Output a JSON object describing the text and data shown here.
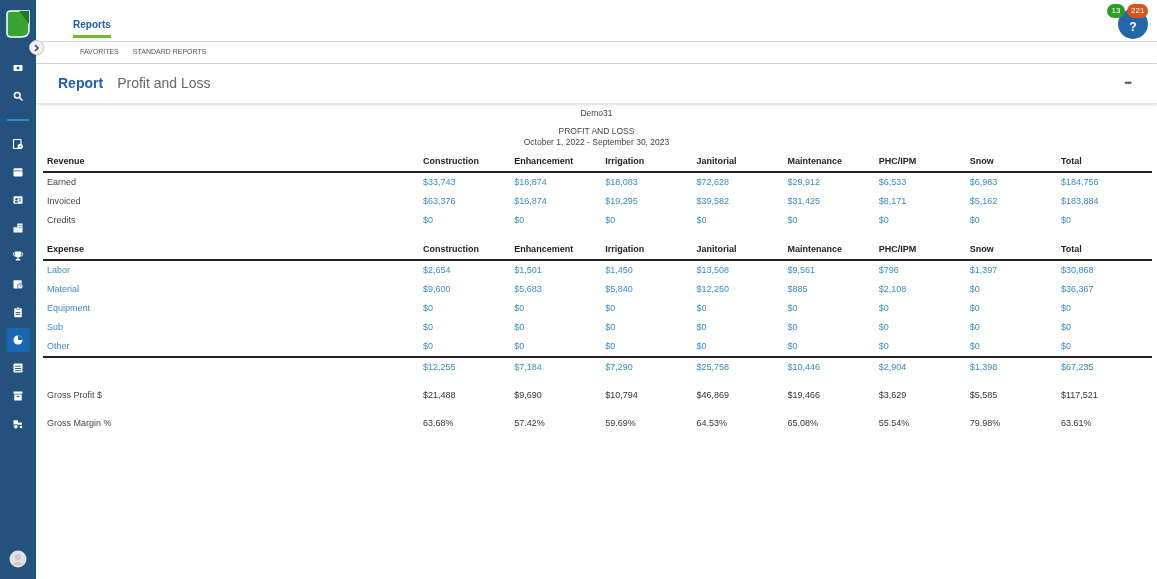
{
  "sidebar": {
    "items": [
      {
        "kind": "cash",
        "selected": false
      },
      {
        "kind": "search",
        "selected": false
      },
      {
        "kind": "divider"
      },
      {
        "kind": "calendar-check",
        "selected": false
      },
      {
        "kind": "calendar",
        "selected": false
      },
      {
        "kind": "contact-card",
        "selected": false
      },
      {
        "kind": "buildings",
        "selected": false
      },
      {
        "kind": "trophy",
        "selected": false
      },
      {
        "kind": "calendar-clock",
        "selected": false
      },
      {
        "kind": "clipboard",
        "selected": false
      },
      {
        "kind": "pie",
        "selected": true
      },
      {
        "kind": "list",
        "selected": false
      },
      {
        "kind": "archive",
        "selected": false
      },
      {
        "kind": "tractor",
        "selected": false
      }
    ]
  },
  "tabs": [
    {
      "label": "Reports",
      "selected": true
    }
  ],
  "subtabs": [
    {
      "label": "FAVORITES"
    },
    {
      "label": "STANDARD REPORTS"
    }
  ],
  "help": {
    "label": "?",
    "badges": [
      {
        "text": "13",
        "color": "#2e9b2b"
      },
      {
        "text": "221",
        "color": "#d9531e"
      }
    ]
  },
  "header": {
    "title": "Report",
    "subtitle": "Profit and Loss",
    "menu": "•••"
  },
  "report": {
    "company": "Demo31",
    "title": "PROFIT AND LOSS",
    "period": "October 1, 2022 - September 30, 2023",
    "rows": [
      {
        "kind": "header",
        "cells": [
          "Revenue",
          "Construction",
          "Enhancement",
          "Irrigation",
          "Janitorial",
          "Maintenance",
          "PHC/IPM",
          "Snow",
          "Total"
        ]
      },
      {
        "kind": "plain",
        "cells": [
          "Earned",
          "$33,743",
          "$16,874",
          "$18,083",
          "$72,628",
          "$29,912",
          "$6,533",
          "$6,983",
          "$184,756"
        ]
      },
      {
        "kind": "plain",
        "cells": [
          "Invoiced",
          "$63,376",
          "$16,874",
          "$19,295",
          "$39,582",
          "$31,425",
          "$8,171",
          "$5,162",
          "$183,884"
        ]
      },
      {
        "kind": "plain",
        "cells": [
          "Credits",
          "$0",
          "$0",
          "$0",
          "$0",
          "$0",
          "$0",
          "$0",
          "$0"
        ]
      },
      {
        "kind": "header",
        "cells": [
          "Expense",
          "Construction",
          "Enhancement",
          "Irrigation",
          "Janitorial",
          "Maintenance",
          "PHC/IPM",
          "Snow",
          "Total"
        ]
      },
      {
        "kind": "link",
        "cells": [
          "Labor",
          "$2,654",
          "$1,501",
          "$1,450",
          "$13,508",
          "$9,561",
          "$796",
          "$1,397",
          "$30,868"
        ]
      },
      {
        "kind": "link",
        "cells": [
          "Material",
          "$9,600",
          "$5,683",
          "$5,840",
          "$12,250",
          "$885",
          "$2,108",
          "$0",
          "$36,367"
        ]
      },
      {
        "kind": "link",
        "cells": [
          "Equipment",
          "$0",
          "$0",
          "$0",
          "$0",
          "$0",
          "$0",
          "$0",
          "$0"
        ]
      },
      {
        "kind": "link",
        "cells": [
          "Sub",
          "$0",
          "$0",
          "$0",
          "$0",
          "$0",
          "$0",
          "$0",
          "$0"
        ]
      },
      {
        "kind": "link",
        "cells": [
          "Other",
          "$0",
          "$0",
          "$0",
          "$0",
          "$0",
          "$0",
          "$0",
          "$0"
        ]
      },
      {
        "kind": "total",
        "cells": [
          "",
          "$12,255",
          "$7,184",
          "$7,290",
          "$25,758",
          "$10,446",
          "$2,904",
          "$1,398",
          "$67,235"
        ]
      },
      {
        "kind": "summary",
        "cells": [
          "Gross Profit $",
          "$21,488",
          "$9,690",
          "$10,794",
          "$46,869",
          "$19,466",
          "$3,629",
          "$5,585",
          "$117,521"
        ]
      },
      {
        "kind": "summary",
        "cells": [
          "Gross Margin %",
          "63.68%",
          "57.42%",
          "59.69%",
          "64.53%",
          "65.08%",
          "55.54%",
          "79.98%",
          "63.61%"
        ]
      }
    ]
  }
}
